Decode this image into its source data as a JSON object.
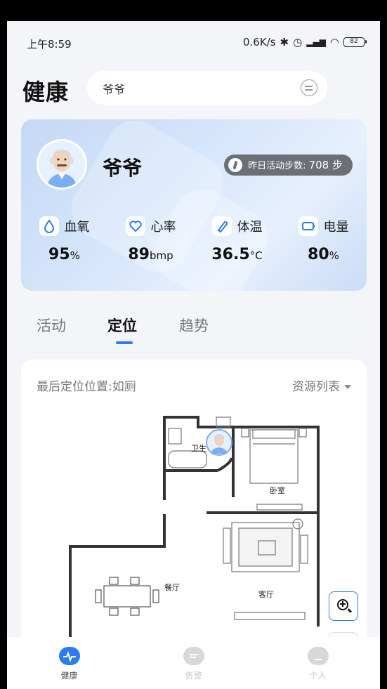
{
  "status_bar": {
    "time": "上午8:59",
    "network_speed": "0.6K/s",
    "battery": "82"
  },
  "header": {
    "title": "健康",
    "search_value": "爷爷"
  },
  "health_card": {
    "name": "爷爷",
    "steps_label": "昨日活动步数:",
    "steps_value": "708 步",
    "metrics": [
      {
        "label": "血氧",
        "value": "95",
        "unit": "%",
        "icon": "drop-icon"
      },
      {
        "label": "心率",
        "value": "89",
        "unit": "bmp",
        "icon": "heart-icon"
      },
      {
        "label": "体温",
        "value": "36.5",
        "unit": "°C",
        "icon": "thermometer-icon"
      },
      {
        "label": "电量",
        "value": "80",
        "unit": "%",
        "icon": "battery-icon"
      }
    ]
  },
  "tabs": [
    {
      "label": "活动",
      "active": false
    },
    {
      "label": "定位",
      "active": true
    },
    {
      "label": "趋势",
      "active": false
    }
  ],
  "location": {
    "last_position": "最后定位位置:如厕",
    "resource_list": "资源列表",
    "rooms": {
      "bathroom": "卫生",
      "bedroom": "卧室",
      "dining": "餐厅",
      "living": "客厅"
    }
  },
  "bottom_nav": [
    {
      "label": "健康",
      "active": true
    },
    {
      "label": "告警",
      "active": false
    },
    {
      "label": "个人",
      "active": false
    }
  ],
  "colors": {
    "accent": "#2b7cf0",
    "card_gradient": "#c9dcf7"
  }
}
